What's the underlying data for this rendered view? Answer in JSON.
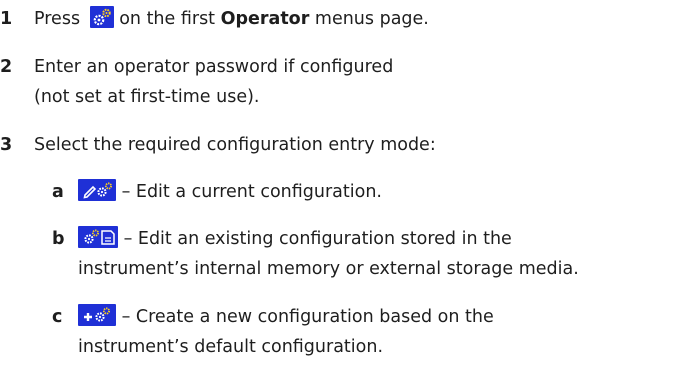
{
  "steps": [
    {
      "num": "1",
      "pre": "Press",
      "mid": " on the first ",
      "bold": "Operator",
      "post": " menus page.",
      "icon": "settings-gears-icon"
    },
    {
      "num": "2",
      "line1": "Enter an operator password if configured",
      "line2": "(not set at first-time use)."
    },
    {
      "num": "3",
      "line1": "Select the required configuration entry mode:"
    }
  ],
  "substeps": [
    {
      "letter": "a",
      "icon": "edit-config-icon",
      "line1": "– Edit a current configuration."
    },
    {
      "letter": "b",
      "icon": "config-storage-icon",
      "line1": "– Edit an existing configuration stored in the",
      "line2": "instrument’s internal memory or external storage media."
    },
    {
      "letter": "c",
      "icon": "new-config-icon",
      "line1": "– Create a new configuration based on the",
      "line2": "instrument’s default configuration."
    }
  ],
  "colors": {
    "icon_bg": "#1f30d6",
    "icon_fg": "#ffffff",
    "gear_accent": "#ffd21a"
  }
}
